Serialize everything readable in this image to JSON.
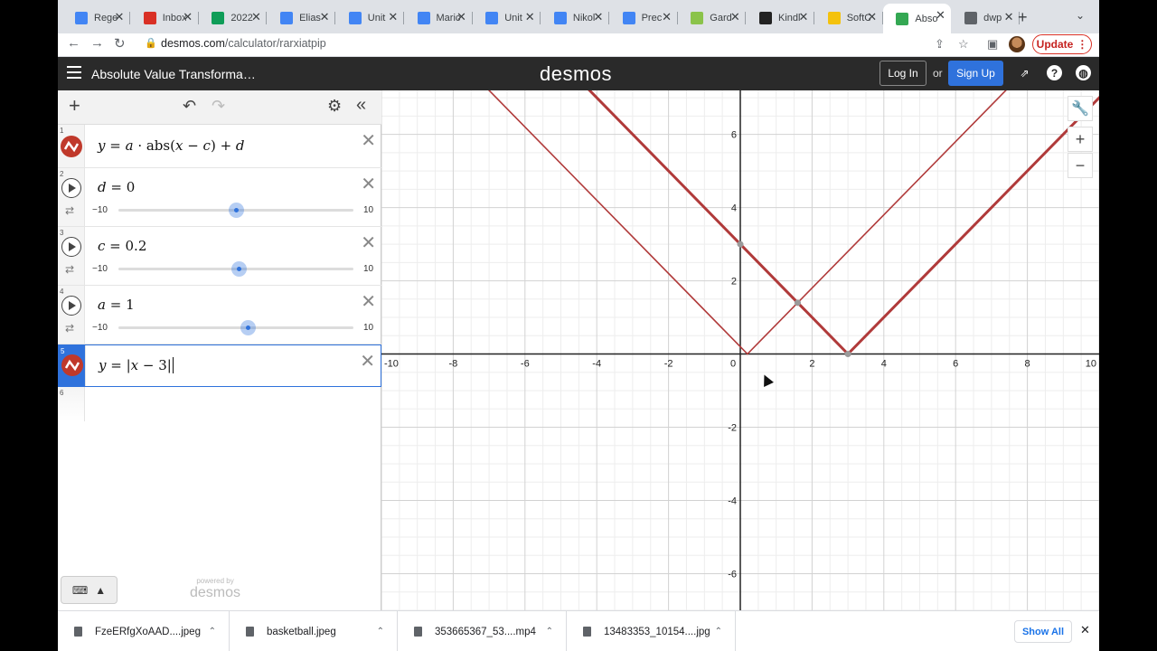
{
  "browser": {
    "tabs": [
      {
        "title": "Rege",
        "icon": "docs-icon",
        "color": "#4285f4"
      },
      {
        "title": "Inbox",
        "icon": "gmail-icon",
        "color": "#d93025"
      },
      {
        "title": "2022",
        "icon": "drive-icon",
        "color": "#0f9d58"
      },
      {
        "title": "Elias",
        "icon": "docs-icon",
        "color": "#4285f4"
      },
      {
        "title": "Unit",
        "icon": "docs-icon",
        "color": "#4285f4"
      },
      {
        "title": "Maric",
        "icon": "docs-icon",
        "color": "#4285f4"
      },
      {
        "title": "Unit",
        "icon": "docs-icon",
        "color": "#4285f4"
      },
      {
        "title": "Nikol",
        "icon": "docs-icon",
        "color": "#4285f4"
      },
      {
        "title": "Prec",
        "icon": "docs-icon",
        "color": "#4285f4"
      },
      {
        "title": "Gard",
        "icon": "leaf-icon",
        "color": "#8bc34a"
      },
      {
        "title": "Kindl",
        "icon": "kindle-icon",
        "color": "#222222"
      },
      {
        "title": "SoftC",
        "icon": "pencil-icon",
        "color": "#f4c20d"
      },
      {
        "title": "Abso",
        "icon": "desmos-icon",
        "color": "#34a853",
        "active": true
      },
      {
        "title": "dwp",
        "icon": "globe-icon",
        "color": "#5f6368"
      }
    ],
    "url_host": "desmos.com",
    "url_path": "/calculator/rarxiatpip",
    "update_label": "Update"
  },
  "header": {
    "graph_title": "Absolute Value Transforma…",
    "logo": "desmos",
    "login_label": "Log In",
    "or_label": "or",
    "signup_label": "Sign Up"
  },
  "expressions": {
    "items": [
      {
        "index": "1",
        "type": "expression"
      },
      {
        "index": "2",
        "type": "slider",
        "var": "d",
        "value": "0",
        "min": "−10",
        "max": "10",
        "position": 0.5
      },
      {
        "index": "3",
        "type": "slider",
        "var": "c",
        "value": "0.2",
        "min": "−10",
        "max": "10",
        "position": 0.51
      },
      {
        "index": "4",
        "type": "slider",
        "var": "a",
        "value": "1",
        "min": "−10",
        "max": "10",
        "position": 0.55
      },
      {
        "index": "5",
        "type": "expression"
      },
      {
        "index": "6",
        "type": "empty"
      }
    ],
    "eq1": {
      "y": "y",
      "a": "a",
      "abs": "abs",
      "x": "x",
      "c": "c",
      "d": "d"
    },
    "eq5": {
      "y": "y",
      "x": "x",
      "num": "3"
    },
    "powered_by": "powered by",
    "powered_logo": "desmos"
  },
  "graph": {
    "x_ticks": [
      "-10",
      "-8",
      "-6",
      "-4",
      "-2",
      "0",
      "2",
      "4",
      "6",
      "8",
      "10"
    ],
    "y_ticks": [
      "6",
      "4",
      "2",
      "-2",
      "-4",
      "-6"
    ],
    "x_range": [
      -10,
      10
    ],
    "y_range": [
      -7,
      7.2
    ],
    "curve_color": "#b03a3a",
    "curves": [
      {
        "name": "y = a·|x − c| + d",
        "vertex_x": 0.2,
        "vertex_y": 0,
        "slope": 1,
        "weight": "thin"
      },
      {
        "name": "y = |x − 3|",
        "vertex_x": 3,
        "vertex_y": 0,
        "slope": 1,
        "weight": "thick"
      }
    ],
    "points": [
      [
        0,
        3
      ],
      [
        1.6,
        1.4
      ],
      [
        3,
        0
      ]
    ]
  },
  "downloads": {
    "items": [
      {
        "name": "FzeERfgXoAAD....jpeg"
      },
      {
        "name": "basketball.jpeg"
      },
      {
        "name": "353665367_53....mp4"
      },
      {
        "name": "13483353_10154....jpg"
      }
    ],
    "show_all": "Show All"
  }
}
